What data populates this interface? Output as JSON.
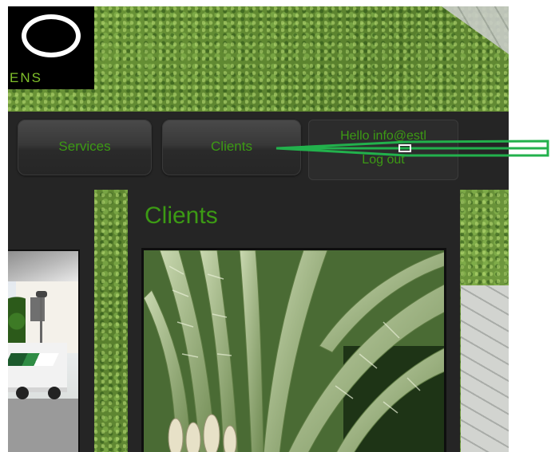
{
  "logo": {
    "text": "ENS"
  },
  "nav": {
    "services_label": "Services",
    "clients_label": "Clients",
    "user_greeting": "Hello info@estl",
    "logout_label": "Log out"
  },
  "content": {
    "title": "Clients"
  },
  "colors": {
    "accent_green": "#3c9a14",
    "panel_dark": "#252525",
    "pointer_green": "#22b14c"
  },
  "icons": {
    "logo": "circle-ring-logo"
  }
}
